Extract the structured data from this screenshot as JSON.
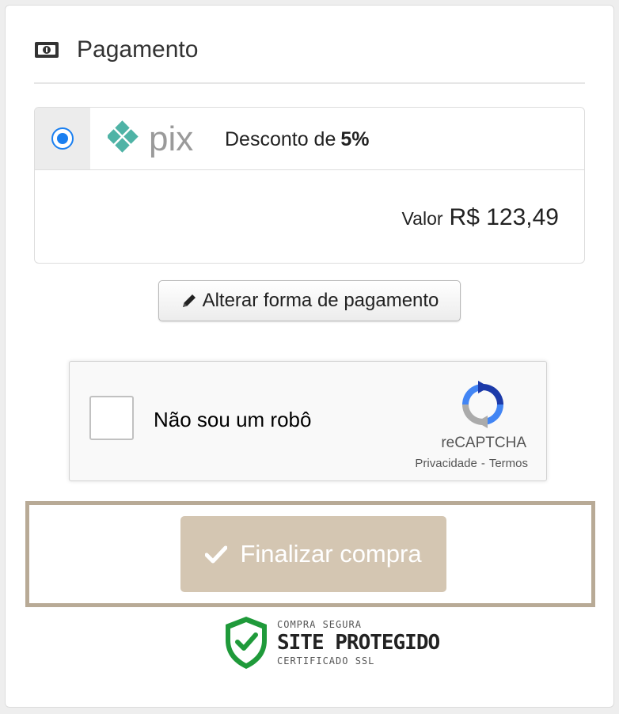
{
  "header": {
    "title": "Pagamento",
    "icon": "money-icon"
  },
  "payment_option": {
    "selected": true,
    "logo_text": "pix",
    "discount_prefix": "Desconto de",
    "discount_value": "5%",
    "price_label": "Valor",
    "price_value": "R$ 123,49"
  },
  "alter_button": {
    "label": "Alterar forma de pagamento",
    "icon": "pencil-icon"
  },
  "captcha": {
    "label": "Não sou um robô",
    "brand": "reCAPTCHA",
    "privacy": "Privacidade",
    "separator": "-",
    "terms": "Termos"
  },
  "finalize_button": {
    "label": "Finalizar compra",
    "icon": "check-icon"
  },
  "seal": {
    "top": "COMPRA SEGURA",
    "main": "SITE PROTEGIDO",
    "bottom": "CERTIFICADO SSL",
    "icon": "shield-check-icon"
  },
  "colors": {
    "radio_blue": "#1a7ff0",
    "pix_teal": "#4fb3a6",
    "finalize_bg": "#d4c6b2",
    "finalize_frame": "#b8aa96",
    "seal_green": "#1f9a3a"
  }
}
